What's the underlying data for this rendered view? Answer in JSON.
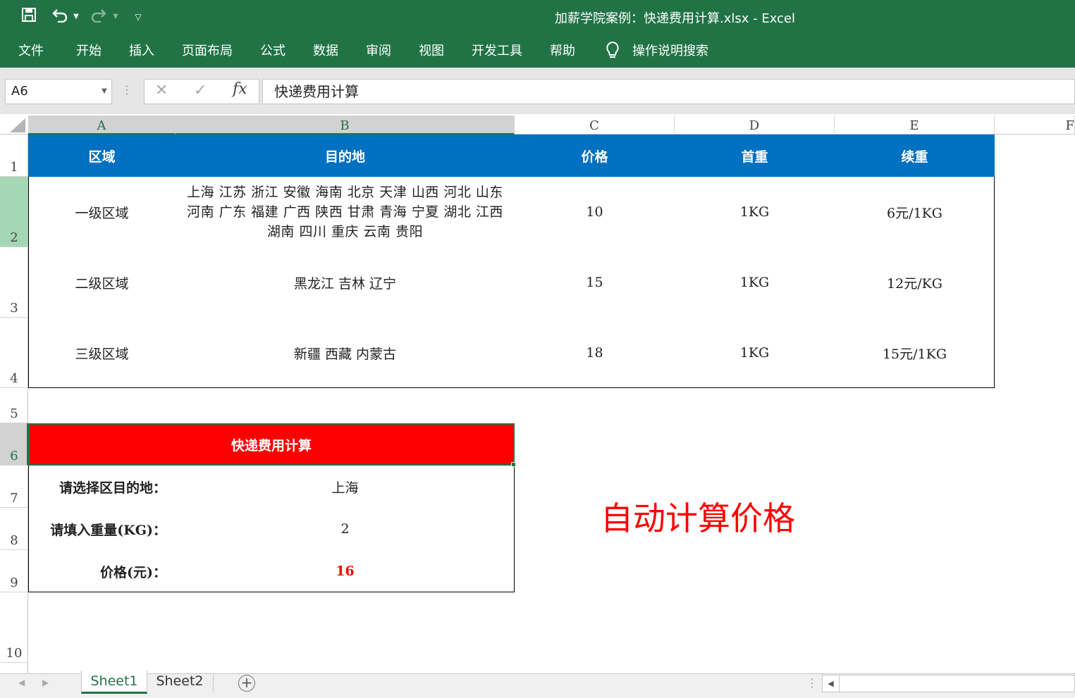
{
  "window": {
    "title": "加薪学院案例：快递费用计算.xlsx  -  Excel",
    "colors": {
      "brand": "#217346",
      "table_header": "#0070c0",
      "calc_header": "#ff0000",
      "result_text": "#ff0000"
    }
  },
  "quick_access": {
    "save_icon": "save-icon",
    "undo_icon": "undo-icon",
    "redo_icon": "redo-icon",
    "customize_icon": "customize-quick-access-icon"
  },
  "ribbon": {
    "tabs": [
      "文件",
      "开始",
      "插入",
      "页面布局",
      "公式",
      "数据",
      "审阅",
      "视图",
      "开发工具",
      "帮助"
    ],
    "tell_me": "操作说明搜索"
  },
  "formula_bar": {
    "name_box": "A6",
    "cancel_icon": "✕",
    "enter_icon": "✓",
    "fx_label": "fx",
    "content": "快递费用计算"
  },
  "grid": {
    "columns": [
      "A",
      "B",
      "C",
      "D",
      "E",
      "F"
    ],
    "rows": [
      "1",
      "2",
      "3",
      "4",
      "5",
      "6",
      "7",
      "8",
      "9",
      "10"
    ]
  },
  "zone_table": {
    "headers": [
      "区域",
      "目的地",
      "价格",
      "首重",
      "续重"
    ],
    "rows": [
      {
        "zone": "一级区域",
        "dest": "上海 江苏 浙江 安徽 海南 北京 天津 山西 河北 山东 河南 广东 福建 广西 陕西 甘肃 青海 宁夏 湖北 江西 湖南 四川 重庆 云南 贵阳",
        "price": "10",
        "first": "1KG",
        "extra": "6元/1KG"
      },
      {
        "zone": "二级区域",
        "dest": "黑龙江 吉林 辽宁",
        "price": "15",
        "first": "1KG",
        "extra": "12元/KG"
      },
      {
        "zone": "三级区域",
        "dest": "新疆 西藏 内蒙古",
        "price": "18",
        "first": "1KG",
        "extra": "15元/1KG"
      }
    ]
  },
  "calculator": {
    "title": "快递费用计算",
    "dest_label": "请选择区目的地：",
    "dest_value": "上海",
    "weight_label": "请填入重量(KG)：",
    "weight_value": "2",
    "price_label": "价格(元)：",
    "price_value": "16"
  },
  "annotation": "自动计算价格",
  "sheets": [
    "Sheet1",
    "Sheet2"
  ],
  "active_sheet": "Sheet1"
}
